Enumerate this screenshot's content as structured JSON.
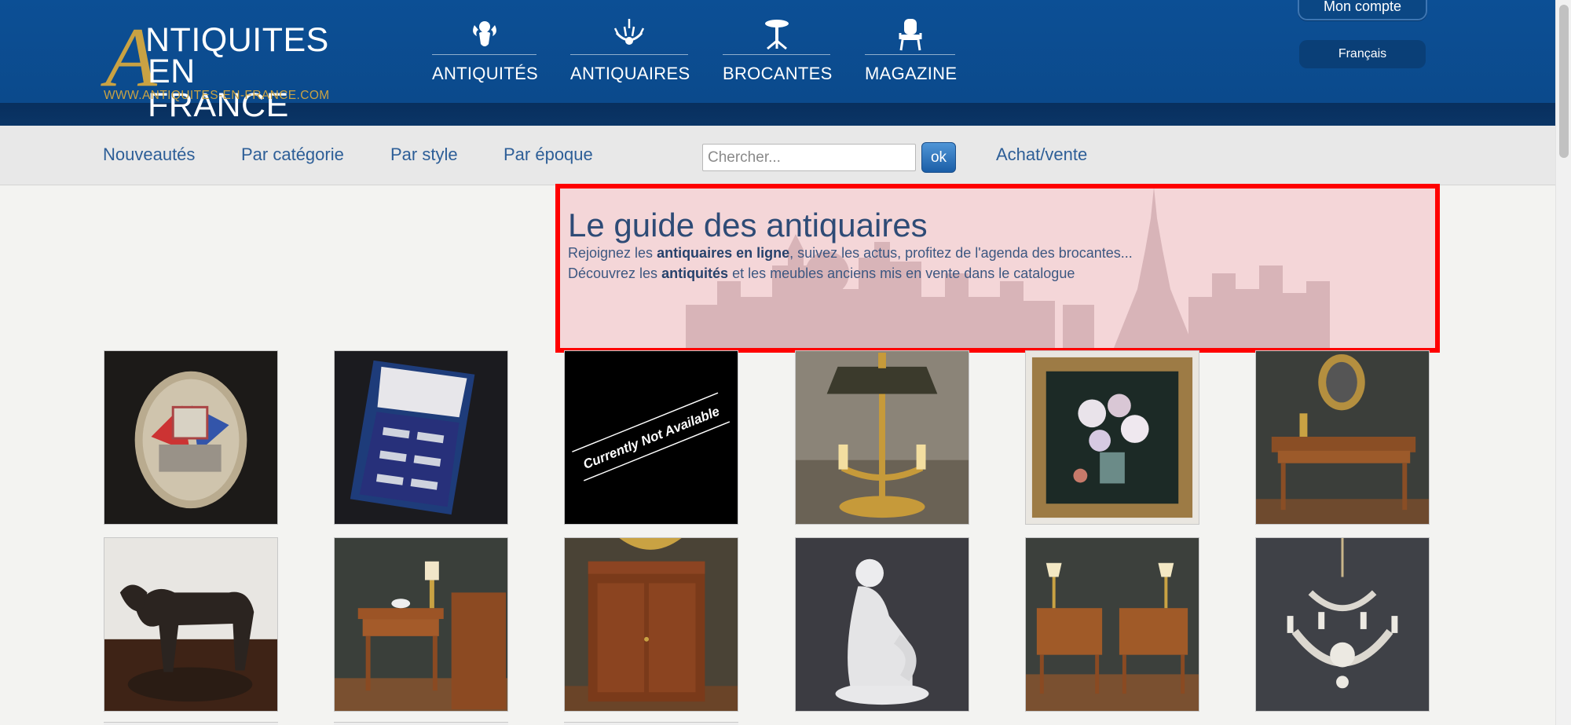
{
  "header": {
    "logo": {
      "line1": "NTIQUITES",
      "line2": "EN FRANCE",
      "initial": "A",
      "url": "WWW.ANTIQUITES-EN-FRANCE.COM"
    },
    "nav": [
      {
        "label": "ANTIQUITÉS",
        "icon": "cherub-icon"
      },
      {
        "label": "ANTIQUAIRES",
        "icon": "chandelier-icon"
      },
      {
        "label": "BROCANTES",
        "icon": "pedestal-table-icon"
      },
      {
        "label": "MAGAZINE",
        "icon": "armchair-icon"
      }
    ],
    "account_label": "Mon compte",
    "language_label": "Français"
  },
  "subnav": {
    "items": [
      "Nouveautés",
      "Par catégorie",
      "Par style",
      "Par époque"
    ],
    "search": {
      "placeholder": "Chercher...",
      "button": "ok"
    },
    "buy_sell": "Achat/vente"
  },
  "hero": {
    "title": "Le guide des antiquaires",
    "line1": {
      "pre": "Rejoignez les ",
      "bold": "antiquaires en ligne",
      "post": ", suivez les actus, profitez de l'agenda des brocantes..."
    },
    "line2": {
      "pre": "Découvrez les ",
      "bold": "antiquités",
      "post": " et les meubles anciens mis en vente dans le catalogue"
    }
  },
  "products": [
    {
      "name": "monte-carlo-rally-plaque"
    },
    {
      "name": "knife-rests-box-set"
    },
    {
      "name": "currently-not-available",
      "text": "Currently Not Available"
    },
    {
      "name": "bouillotte-lamp"
    },
    {
      "name": "flower-painting-gilt-frame"
    },
    {
      "name": "writing-desk"
    },
    {
      "name": "bronze-dog-sculpture"
    },
    {
      "name": "side-table-with-lamp"
    },
    {
      "name": "mahogany-cabinet"
    },
    {
      "name": "porcelain-bather-statue"
    },
    {
      "name": "pair-of-bedside-tables"
    },
    {
      "name": "crystal-chandelier"
    }
  ]
}
